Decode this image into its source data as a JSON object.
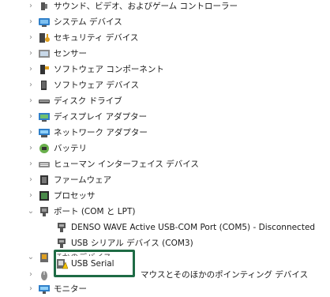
{
  "tree": {
    "items": [
      {
        "label": "サウンド、ビデオ、およびゲーム コントローラー",
        "icon": "speaker-icon",
        "expanded": false
      },
      {
        "label": "システム デバイス",
        "icon": "system-device-icon",
        "expanded": false
      },
      {
        "label": "セキュリティ デバイス",
        "icon": "security-key-icon",
        "expanded": false
      },
      {
        "label": "センサー",
        "icon": "sensor-icon",
        "expanded": false
      },
      {
        "label": "ソフトウェア コンポーネント",
        "icon": "software-component-icon",
        "expanded": false
      },
      {
        "label": "ソフトウェア デバイス",
        "icon": "software-device-icon",
        "expanded": false
      },
      {
        "label": "ディスク ドライブ",
        "icon": "disk-drive-icon",
        "expanded": false
      },
      {
        "label": "ディスプレイ アダプター",
        "icon": "display-adapter-icon",
        "expanded": false
      },
      {
        "label": "ネットワーク アダプター",
        "icon": "network-adapter-icon",
        "expanded": false
      },
      {
        "label": "バッテリ",
        "icon": "battery-icon",
        "expanded": false
      },
      {
        "label": "ヒューマン インターフェイス デバイス",
        "icon": "hid-icon",
        "expanded": false
      },
      {
        "label": "ファームウェア",
        "icon": "firmware-icon",
        "expanded": false
      },
      {
        "label": "プロセッサ",
        "icon": "processor-icon",
        "expanded": false
      },
      {
        "label": "ポート (COM と LPT)",
        "icon": "port-icon",
        "expanded": true
      },
      {
        "label": "DENSO WAVE Active USB-COM Port (COM5) - Disconnected",
        "icon": "port-connector-icon",
        "child": true
      },
      {
        "label": "USB シリアル デバイス (COM3)",
        "icon": "port-connector-icon",
        "child": true
      },
      {
        "label": "ほかのデバイス",
        "icon": "unknown-device-icon",
        "expanded": true
      },
      {
        "label": "USB Serial",
        "icon": "unknown-device-warning-icon",
        "child": true
      },
      {
        "label": "マウスとそのほかのポインティング デバイス",
        "icon": "mouse-icon",
        "expanded": false
      },
      {
        "label": "モニター",
        "icon": "monitor-icon",
        "expanded": false
      }
    ]
  },
  "colors": {
    "highlight_border": "#1e6b45",
    "expand_chevron": "#8a8a8a"
  }
}
